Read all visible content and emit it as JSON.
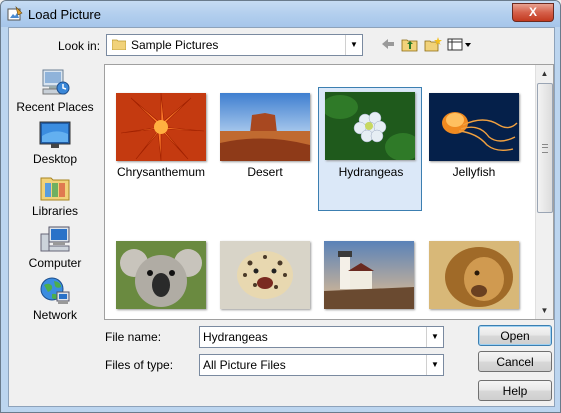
{
  "window": {
    "title": "Load Picture",
    "close_glyph": "X"
  },
  "lookin": {
    "label": "Look in:",
    "value": "Sample Pictures"
  },
  "toolbar": {
    "icons": [
      "back-arrow-icon",
      "up-folder-icon",
      "new-folder-icon",
      "view-menu-icon"
    ]
  },
  "places": [
    {
      "label": "Recent Places",
      "icon": "recent-places-icon"
    },
    {
      "label": "Desktop",
      "icon": "desktop-icon"
    },
    {
      "label": "Libraries",
      "icon": "libraries-icon"
    },
    {
      "label": "Computer",
      "icon": "computer-icon"
    },
    {
      "label": "Network",
      "icon": "network-icon"
    }
  ],
  "files": [
    {
      "label": "Chrysanthemum",
      "selected": false
    },
    {
      "label": "Desert",
      "selected": false
    },
    {
      "label": "Hydrangeas",
      "selected": true
    },
    {
      "label": "Jellyfish",
      "selected": false
    },
    {
      "label": "",
      "selected": false
    },
    {
      "label": "",
      "selected": false
    },
    {
      "label": "",
      "selected": false
    },
    {
      "label": "",
      "selected": false
    }
  ],
  "filename": {
    "label": "File name:",
    "value": "Hydrangeas"
  },
  "filetype": {
    "label": "Files of type:",
    "value": "All Picture Files"
  },
  "buttons": {
    "open": "Open",
    "cancel": "Cancel",
    "help": "Help"
  },
  "colors": {
    "titlebar": "#b3cfee",
    "selection": "#dbe8f8",
    "selection_border": "#3c7fb1"
  }
}
